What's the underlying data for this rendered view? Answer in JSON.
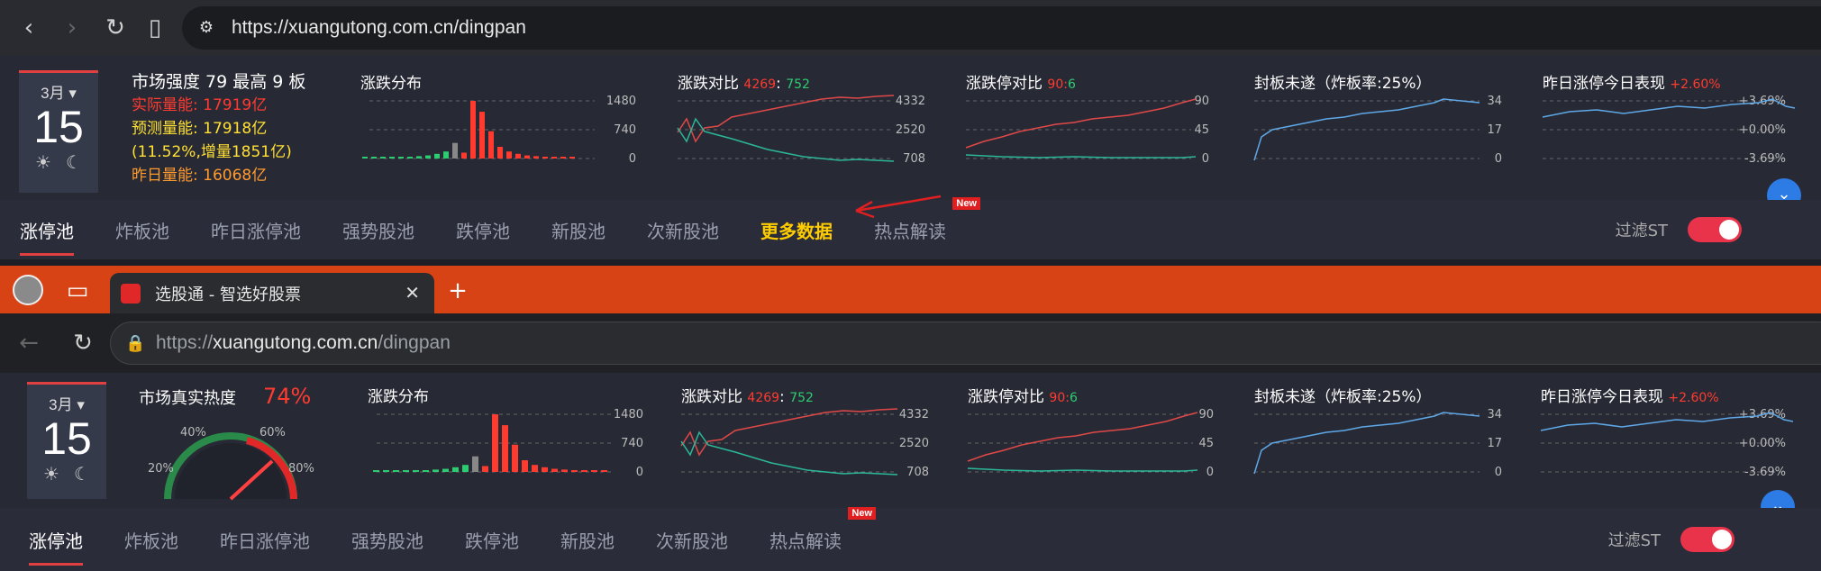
{
  "browser1": {
    "url": "https://xuangutong.com.cn/dingpan"
  },
  "browser2": {
    "tab_title": "选股通 - 智选好股票",
    "url_prefix": "https://",
    "url_host": "xuangutong.com.cn",
    "url_path": "/dingpan"
  },
  "panel1": {
    "month": "3月",
    "day": "15",
    "strength": "市场强度 79 最高 9 板",
    "actual": "实际量能:  17919亿",
    "predicted": "预测量能:  17918亿",
    "predicted_change": "(11.52%,增量1851亿)",
    "yesterday": "昨日量能:  16068亿"
  },
  "panel2": {
    "month": "3月",
    "day": "15",
    "heat_title": "市场真实热度",
    "heat_value": "74%",
    "gauge_labels": [
      "20%",
      "40%",
      "60%",
      "80%"
    ]
  },
  "charts": {
    "dist": {
      "title": "涨跌分布",
      "ticks": [
        "1480",
        "740",
        "0"
      ]
    },
    "ratio": {
      "title": "涨跌对比",
      "up": "4269",
      "sep": ":",
      "down": "752",
      "ticks": [
        "4332",
        "2520",
        "708"
      ]
    },
    "limit": {
      "title": "涨跌停对比",
      "up": "90",
      "sep": ":",
      "down": "6",
      "ticks": [
        "90",
        "45",
        "0"
      ]
    },
    "seal": {
      "title": "封板未遂（炸板率:25%）",
      "ticks": [
        "34",
        "17",
        "0"
      ]
    },
    "yest": {
      "title": "昨日涨停今日表现",
      "change": "+2.60%",
      "ticks": [
        "+3.69%",
        "+0.00%",
        "-3.69%"
      ]
    }
  },
  "chart_data": [
    {
      "type": "bar",
      "title": "涨跌分布",
      "values": [
        5,
        0,
        0,
        20,
        30,
        40,
        60,
        80,
        120,
        180,
        400,
        150,
        1480,
        1200,
        700,
        300,
        180,
        120,
        80,
        60,
        40,
        30,
        20,
        40
      ],
      "ylim": [
        0,
        1480
      ]
    },
    {
      "type": "line",
      "title": "涨跌对比",
      "series": [
        {
          "name": "4269",
          "end": 4269
        },
        {
          "name": "752",
          "end": 752
        }
      ],
      "ylim": [
        708,
        4332
      ]
    },
    {
      "type": "line",
      "title": "涨跌停对比",
      "series": [
        {
          "name": "90",
          "end": 90
        },
        {
          "name": "6",
          "end": 6
        }
      ],
      "ylim": [
        0,
        90
      ]
    },
    {
      "type": "line",
      "title": "封板未遂（炸板率:25%）",
      "ylim": [
        0,
        34
      ]
    },
    {
      "type": "line",
      "title": "昨日涨停今日表现",
      "ylim": [
        -3.69,
        3.69
      ]
    }
  ],
  "tabs1": [
    "涨停池",
    "炸板池",
    "昨日涨停池",
    "强势股池",
    "跌停池",
    "新股池",
    "次新股池",
    "更多数据",
    "热点解读"
  ],
  "tabs2": [
    "涨停池",
    "炸板池",
    "昨日涨停池",
    "强势股池",
    "跌停池",
    "新股池",
    "次新股池",
    "热点解读"
  ],
  "new_badge": "New",
  "filter_label": "过滤ST",
  "colors": {
    "up": "#ff3b30",
    "down": "#2ecc71",
    "line": "#5fa8e8",
    "accent": "#e8334a",
    "tabbar2": "#d84315"
  }
}
